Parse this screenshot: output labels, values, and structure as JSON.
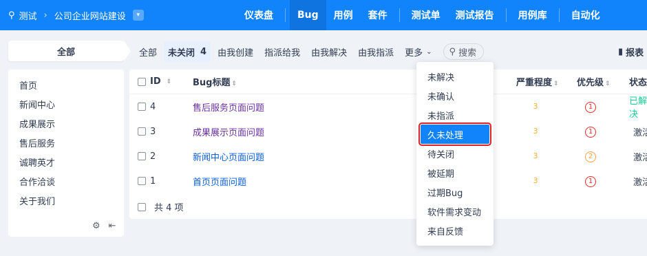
{
  "topbar": {
    "search_label": "测试",
    "project": "公司企业网站建设",
    "nav": [
      "仪表盘",
      "Bug",
      "用例",
      "套件",
      "测试单",
      "测试报告",
      "用例库",
      "自动化"
    ],
    "active_nav": "Bug"
  },
  "subbar": {
    "all_label": "全部",
    "tabs": {
      "all": "全部",
      "unclosed": "未关闭",
      "unclosed_count": "4",
      "created_by_me": "由我创建",
      "assigned_to_me": "指派给我",
      "resolved_by_me": "由我解决",
      "assigned_by_me": "由我指派",
      "more": "更多"
    },
    "search": "搜索",
    "report": "报表"
  },
  "sidebar": {
    "items": [
      "首页",
      "新闻中心",
      "成果展示",
      "售后服务",
      "诚聘英才",
      "合作洽谈",
      "关于我们"
    ]
  },
  "table": {
    "headers": {
      "id": "ID",
      "title": "Bug标题",
      "severity": "严重程度",
      "priority": "优先级",
      "status": "状态"
    },
    "rows": [
      {
        "id": "4",
        "title": "售后服务页面问题",
        "severity": "3",
        "priority": "1",
        "status": "已解决"
      },
      {
        "id": "3",
        "title": "成果展示页面问题",
        "severity": "3",
        "priority": "1",
        "status": "激活"
      },
      {
        "id": "2",
        "title": "新闻中心页面问题",
        "severity": "3",
        "priority": "2",
        "status": "激活"
      },
      {
        "id": "1",
        "title": "首页页面问题",
        "severity": "3",
        "priority": "1",
        "status": "激活"
      }
    ],
    "footer": "共 4 项"
  },
  "dropdown": {
    "options": [
      "未解决",
      "未确认",
      "未指派",
      "久未处理",
      "待关闭",
      "被延期",
      "过期Bug",
      "软件需求变动",
      "来自反馈"
    ],
    "highlighted": "久未处理"
  },
  "colors": {
    "accent": "#1183fb",
    "highlight_border": "#e02020",
    "status_done": "#17ce97"
  }
}
